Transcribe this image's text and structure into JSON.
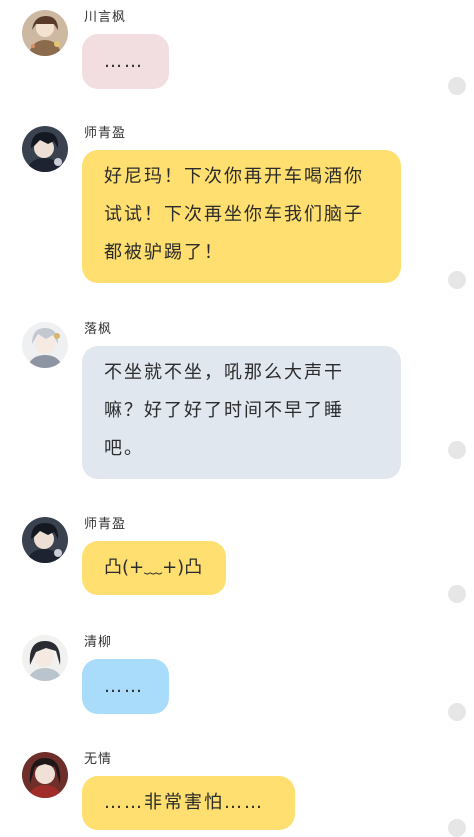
{
  "colors": {
    "pink_bubble": "#f2dde0",
    "yellow_bubble": "#fedf6f",
    "gray_blue_bubble": "#e1e7ee",
    "blue_bubble": "#a8dcfa",
    "status_dot": "#e6e6e6"
  },
  "messages": [
    {
      "sender": "川言枫",
      "text": "……",
      "bubble_color": "pink",
      "avatar": "avatar-chuanyanfeng"
    },
    {
      "sender": "师青盈",
      "text": "好尼玛！下次你再开车喝酒你试试！下次再坐你车我们脑子都被驴踢了！",
      "bubble_color": "yellow",
      "avatar": "avatar-shiqingying"
    },
    {
      "sender": "落枫",
      "text": "不坐就不坐，吼那么大声干嘛？好了好了时间不早了睡吧。",
      "bubble_color": "gray-blue",
      "avatar": "avatar-luofeng"
    },
    {
      "sender": "师青盈",
      "text": "凸(+﹏+)凸",
      "bubble_color": "yellow",
      "avatar": "avatar-shiqingying"
    },
    {
      "sender": "清柳",
      "text": "……",
      "bubble_color": "blue",
      "avatar": "avatar-qingliu"
    },
    {
      "sender": "无情",
      "text": "……非常害怕……",
      "bubble_color": "yellow",
      "avatar": "avatar-wuqing"
    }
  ]
}
